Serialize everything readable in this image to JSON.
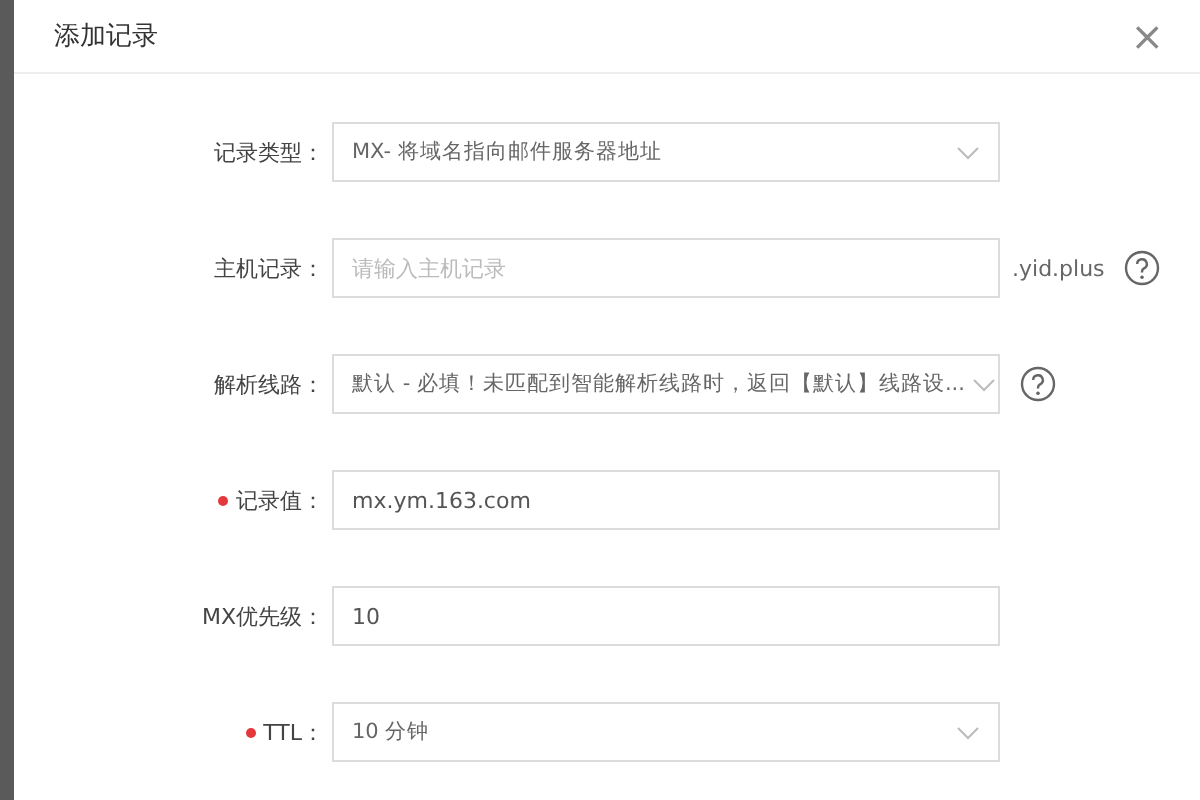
{
  "dialog": {
    "title": "添加记录",
    "close": "×"
  },
  "fields": [
    {
      "label": "记录类型：",
      "kind": "select",
      "required": false,
      "value": "MX- 将域名指向邮件服务器地址"
    },
    {
      "label": "主机记录：",
      "kind": "input",
      "required": false,
      "placeholder": "请输入主机记录",
      "suffix": ".yid.plus",
      "help": true
    },
    {
      "label": "解析线路：",
      "kind": "select",
      "required": false,
      "value": "默认 - 必填！未匹配到智能解析线路时，返回【默认】线路设...",
      "help": true
    },
    {
      "label": "记录值：",
      "kind": "input",
      "required": true,
      "value": "mx.ym.163.com"
    },
    {
      "label": "MX优先级：",
      "kind": "input",
      "required": false,
      "value": "10"
    },
    {
      "label": "TTL：",
      "kind": "select",
      "required": true,
      "value": "10 分钟"
    }
  ]
}
